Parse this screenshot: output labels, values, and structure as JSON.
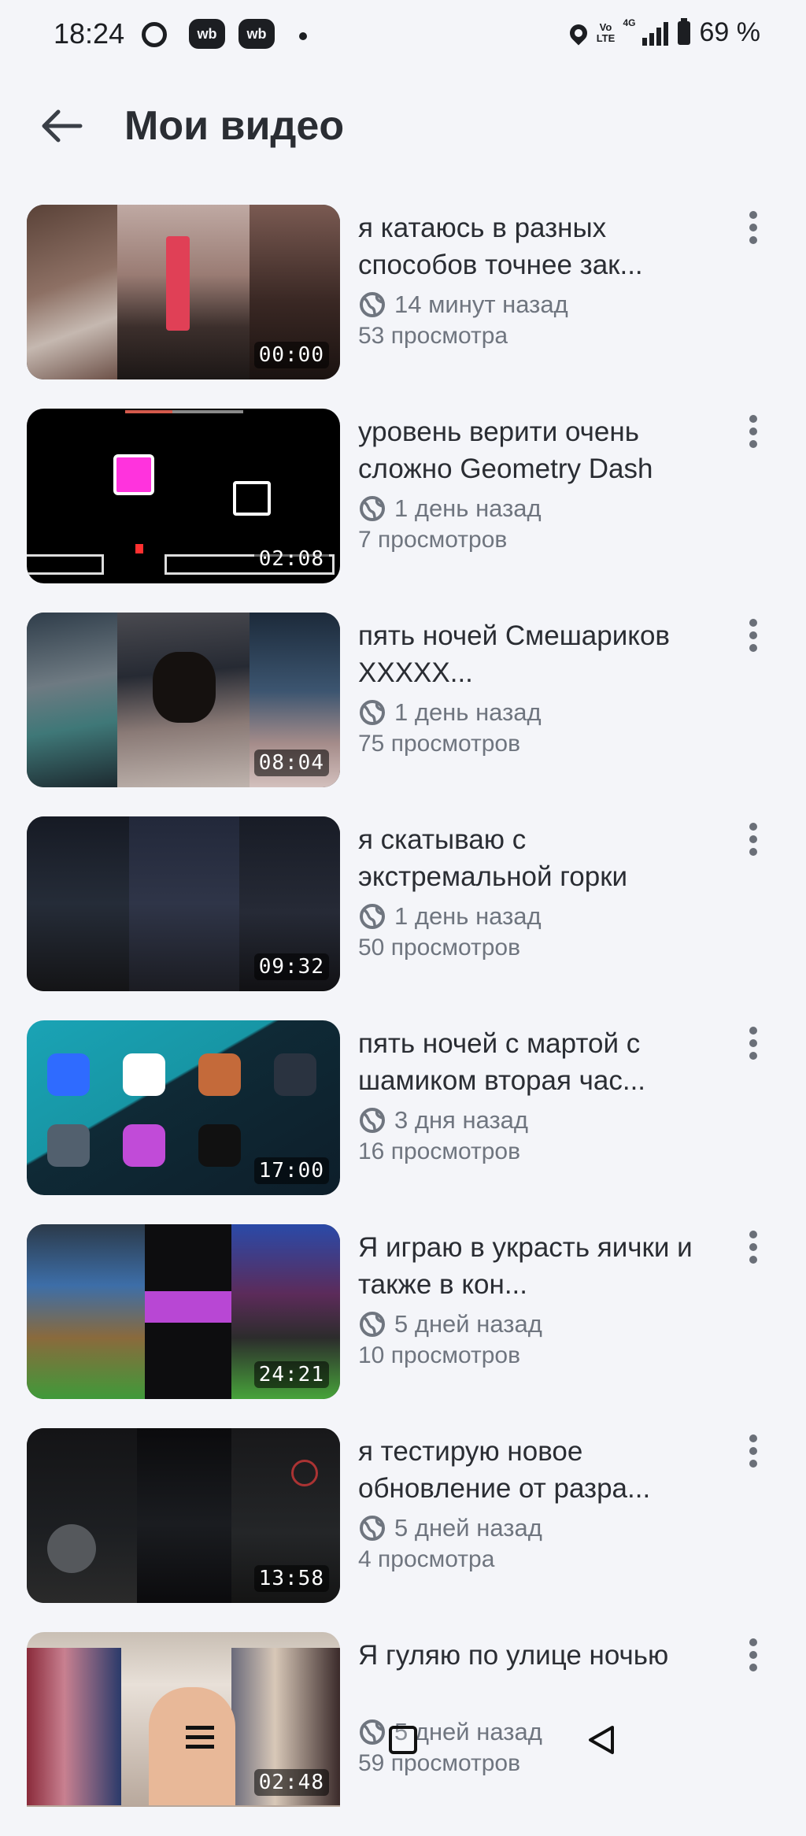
{
  "status_bar": {
    "time": "18:24",
    "badge_1": "wb",
    "badge_2": "wb",
    "volte": "Vo LTE",
    "network": "4G",
    "battery": "69 %"
  },
  "header": {
    "title": "Мои видео"
  },
  "videos": [
    {
      "title": "я катаюсь в разных способов точнее зак...",
      "duration": "00:00",
      "time_ago": "14 минут назад",
      "views": "53 просмотра"
    },
    {
      "title": "уровень верити очень сложно Geometry Dash",
      "duration": "02:08",
      "time_ago": "1 день назад",
      "views": "7 просмотров"
    },
    {
      "title": "пять ночей Смешариков XXXXX...",
      "duration": "08:04",
      "time_ago": "1 день назад",
      "views": "75 просмотров"
    },
    {
      "title": "я скатываю с экстремальной горки",
      "duration": "09:32",
      "time_ago": "1 день назад",
      "views": "50 просмотров"
    },
    {
      "title": "пять ночей с мартой с шамиком вторая час...",
      "duration": "17:00",
      "time_ago": "3 дня назад",
      "views": "16 просмотров"
    },
    {
      "title": "Я играю в украсть яички и также в кон...",
      "duration": "24:21",
      "time_ago": "5 дней назад",
      "views": "10 просмотров"
    },
    {
      "title": "я тестирую новое обновление от разра...",
      "duration": "13:58",
      "time_ago": "5 дней назад",
      "views": "4 просмотра"
    },
    {
      "title": "Я гуляю по улице ночью",
      "duration": "02:48",
      "time_ago": "5 дней назад",
      "views": "59 просмотров"
    }
  ],
  "colors": {
    "background": "#f4f5f9",
    "text": "#2a2d33",
    "secondary_text": "#6f757f"
  },
  "icons": {
    "back": "arrow-left-icon",
    "more": "more-vertical-icon",
    "privacy": "globe-icon"
  }
}
